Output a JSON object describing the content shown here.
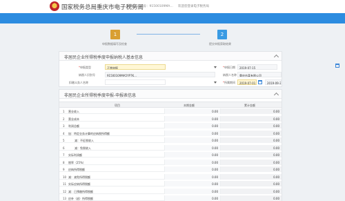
{
  "header": {
    "site_title": "国家税务总局重庆市电子税务局",
    "info1": "纳税人识别号：91500109MA…",
    "info2": "欢迎您登录电子税务局"
  },
  "steps": [
    {
      "num": "1",
      "label": "申报数据填写及检查"
    },
    {
      "num": "2",
      "label": "提交申报获取结果"
    }
  ],
  "panel1": {
    "title": "非居民企业所得税季度申报纳税人基本信息",
    "fields": {
      "type_label": "申报类型",
      "type_value": "正常申报",
      "date_label": "申报日期",
      "date_value": "2019-07-15",
      "name_label": "纳税人识别号",
      "name_value": "91500109MA5YP7K…",
      "orgname_label": "纳税人名称",
      "orgname_value": "重庆市某有限公司",
      "agent_label": "扣缴义务人名称",
      "agent_value": "",
      "period_label": "所属期间",
      "period_start": "2019-07-01",
      "period_end": "2019-09-30"
    }
  },
  "panel2": {
    "title": "非居民企业所得税季度申报-申报表信息",
    "columns": [
      "",
      "项目",
      "本期金额",
      "累计金额"
    ],
    "rows": [
      {
        "num": "1",
        "name": "营业收入",
        "cur": "0.00",
        "cum": "0.00",
        "indent": false
      },
      {
        "num": "2",
        "name": "营业成本",
        "cur": "0.00",
        "cum": "0.00",
        "indent": false
      },
      {
        "num": "3",
        "name": "利润总额",
        "cur": "0.00",
        "cum": "0.00",
        "indent": false
      },
      {
        "num": "4",
        "name": "加：特定业务计算的应纳税所得额",
        "cur": "0.00",
        "cum": "0.00",
        "indent": false
      },
      {
        "num": "5",
        "name": "减：不征税收入",
        "cur": "0.00",
        "cum": "0.00",
        "indent": true
      },
      {
        "num": "6",
        "name": "减：免税收入",
        "cur": "0.00",
        "cum": "0.00",
        "indent": true
      },
      {
        "num": "7",
        "name": "实际利润额",
        "cur": "0.00",
        "cum": "0.00",
        "indent": false
      },
      {
        "num": "8",
        "name": "税率（25%）",
        "cur": "0.00",
        "cum": "0.00",
        "indent": false
      },
      {
        "num": "9",
        "name": "应纳所得税额",
        "cur": "0.00",
        "cum": "0.00",
        "indent": false
      },
      {
        "num": "10",
        "name": "减：减免所得税额",
        "cur": "0.00",
        "cum": "0.00",
        "indent": false
      },
      {
        "num": "11",
        "name": "实际应纳所得税额",
        "cur": "0.00",
        "cum": "0.00",
        "indent": false
      },
      {
        "num": "12",
        "name": "减：已预缴所得税额",
        "cur": "0.00",
        "cum": "0.00",
        "indent": false
      },
      {
        "num": "13",
        "name": "应补（退）所得税额",
        "cur": "0.00",
        "cum": "0.00",
        "indent": false
      }
    ]
  },
  "colors": {
    "brand_blue": "#2c8ce0",
    "step_active": "#d99f32",
    "step_next": "#3a9be3"
  }
}
